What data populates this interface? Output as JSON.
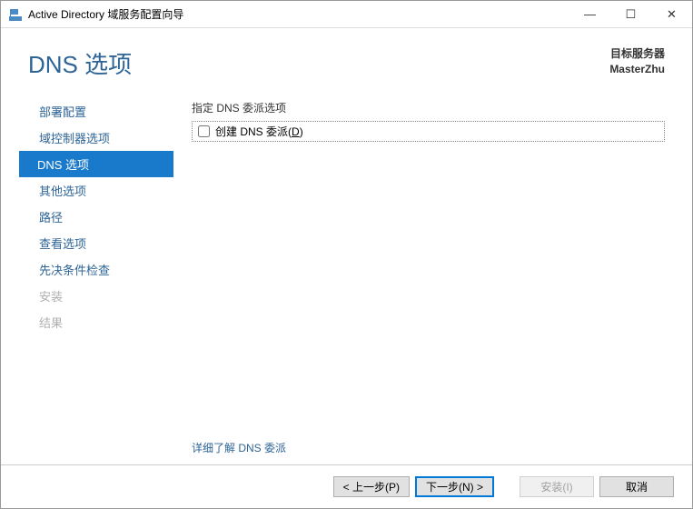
{
  "window": {
    "title": "Active Directory 域服务配置向导"
  },
  "header": {
    "page_title": "DNS 选项",
    "target_label": "目标服务器",
    "target_server": "MasterZhu"
  },
  "sidebar": {
    "items": [
      {
        "label": "部署配置",
        "state": "normal"
      },
      {
        "label": "域控制器选项",
        "state": "normal"
      },
      {
        "label": "DNS 选项",
        "state": "active"
      },
      {
        "label": "其他选项",
        "state": "normal"
      },
      {
        "label": "路径",
        "state": "normal"
      },
      {
        "label": "查看选项",
        "state": "normal"
      },
      {
        "label": "先决条件检查",
        "state": "normal"
      },
      {
        "label": "安装",
        "state": "disabled"
      },
      {
        "label": "结果",
        "state": "disabled"
      }
    ]
  },
  "main": {
    "section_label": "指定 DNS 委派选项",
    "checkbox_label_pre": "创建 DNS 委派(",
    "checkbox_label_key": "D",
    "checkbox_label_post": ")",
    "checkbox_checked": false,
    "learn_more_link": "详细了解 DNS 委派"
  },
  "footer": {
    "prev": "< 上一步(P)",
    "next": "下一步(N) >",
    "install": "安装(I)",
    "cancel": "取消"
  }
}
